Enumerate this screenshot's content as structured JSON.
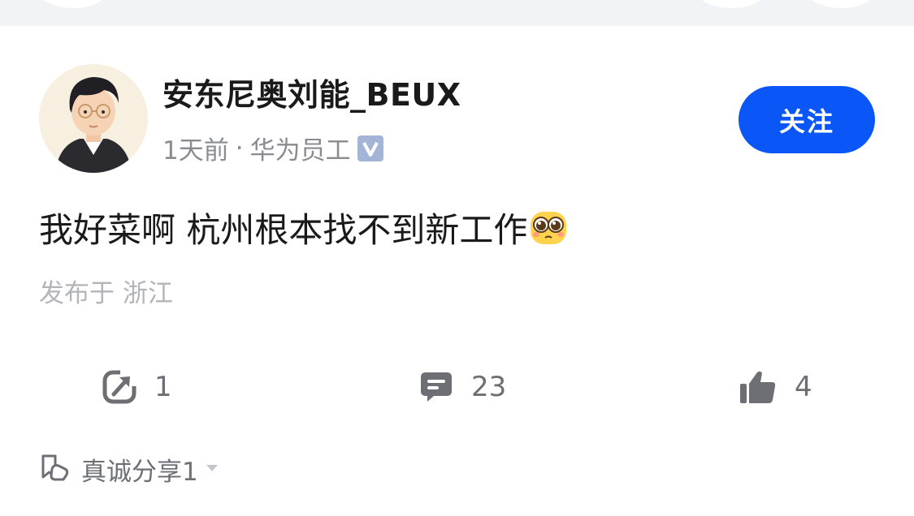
{
  "post": {
    "author": {
      "name": "安东尼奥刘能_BEUX",
      "time": "1天前",
      "separator": "·",
      "affiliation": "华为员工"
    },
    "follow_label": "关注",
    "content_text": "我好菜啊 杭州根本找不到新工作",
    "location": "发布于 浙江",
    "actions": {
      "repost_count": "1",
      "comment_count": "23",
      "like_count": "4"
    },
    "share": {
      "label": "真诚分享1"
    }
  },
  "colors": {
    "accent": "#0a56f6",
    "text_primary": "#1a1a1a",
    "text_secondary": "#8a8c92",
    "text_muted": "#b3b5ba",
    "icon_gray": "#6d6f75",
    "verified_badge": "#a4b4d6"
  },
  "icons": {
    "verified": "verified-badge-icon",
    "repost": "repost-icon",
    "comment": "comment-icon",
    "like": "thumbs-up-icon",
    "share": "bookmark-hands-icon",
    "emoji": "pleading-face-emoji"
  }
}
